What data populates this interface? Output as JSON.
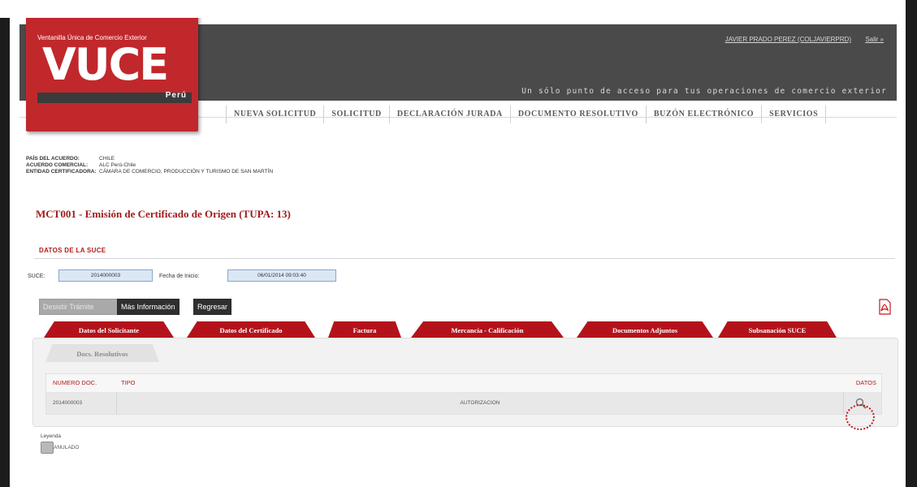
{
  "header": {
    "user_link": "JAVIER PRADO PEREZ (COLJAVIERPRD)",
    "logout_link": "Salir »",
    "slogan": "Un sólo punto de acceso para tus operaciones de comercio exterior",
    "logo_subtitle": "Ventanilla Única de Comercio Exterior",
    "logo_main": "VUCE",
    "logo_country": "Perú"
  },
  "nav": {
    "items": [
      "NUEVA SOLICITUD",
      "SOLICITUD",
      "DECLARACIÓN JURADA",
      "DOCUMENTO RESOLUTIVO",
      "BUZÓN ELECTRÓNICO",
      "SERVICIOS"
    ]
  },
  "info": {
    "pais_label": "PAÍS DEL ACUERDO:",
    "pais_value": "CHILE",
    "acuerdo_label": "ACUERDO COMERCIAL:",
    "acuerdo_value": "ALC Perú-Chile",
    "entidad_label": "ENTIDAD CERTIFICADORA:",
    "entidad_value": "CÁMARA DE COMERCIO, PRODUCCIÓN Y TURISMO DE SAN MARTÍN"
  },
  "page_title": "MCT001 - Emisión de Certificado de Origen (TUPA: 13)",
  "section": {
    "title": "DATOS DE LA SUCE",
    "suce_label": "SUCE:",
    "suce_value": "2014000003",
    "fecha_label": "Fecha de Inicio:",
    "fecha_value": "06/01/2014 09:03:40"
  },
  "buttons": {
    "disabled": "Desistir Trámite",
    "more_info": "Más Información",
    "back": "Regresar"
  },
  "tabs": [
    "Datos del Solicitante",
    "Datos del Certificado",
    "Factura",
    "Mercancía - Calificación",
    "Documentos Adjuntos",
    "Subsanación SUCE"
  ],
  "subtab": "Docs. Resolutivos",
  "table": {
    "headers": {
      "num": "NUMERO DOC.",
      "tipo": "TIPO",
      "datos": "DATOS"
    },
    "rows": [
      {
        "num": "2014000003",
        "tipo": "AUTORIZACION"
      }
    ]
  },
  "legend": {
    "title": "Leyenda",
    "item": "ANULADO"
  },
  "colors": {
    "brand_red": "#c0282c",
    "tab_red": "#b4121b",
    "header_gray": "#4a4a4a"
  }
}
